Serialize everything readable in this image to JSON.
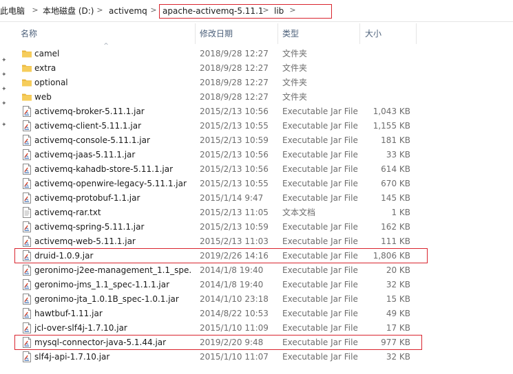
{
  "address_bar": {
    "crumbs": [
      "此电脑",
      "本地磁盘 (D:)",
      "activemq",
      "apache-activemq-5.11.1",
      "lib"
    ],
    "separator": ">"
  },
  "columns": {
    "name": "名称",
    "modified": "修改日期",
    "type": "类型",
    "size": "大小"
  },
  "files": [
    {
      "name": "camel",
      "modified": "2018/9/28 12:27",
      "type": "文件夹",
      "size": "",
      "icon": "folder-icon"
    },
    {
      "name": "extra",
      "modified": "2018/9/28 12:27",
      "type": "文件夹",
      "size": "",
      "icon": "folder-icon"
    },
    {
      "name": "optional",
      "modified": "2018/9/28 12:27",
      "type": "文件夹",
      "size": "",
      "icon": "folder-icon"
    },
    {
      "name": "web",
      "modified": "2018/9/28 12:27",
      "type": "文件夹",
      "size": "",
      "icon": "folder-icon"
    },
    {
      "name": "activemq-broker-5.11.1.jar",
      "modified": "2015/2/13 10:56",
      "type": "Executable Jar File",
      "size": "1,043 KB",
      "icon": "jar-file-icon"
    },
    {
      "name": "activemq-client-5.11.1.jar",
      "modified": "2015/2/13 10:55",
      "type": "Executable Jar File",
      "size": "1,155 KB",
      "icon": "jar-file-icon"
    },
    {
      "name": "activemq-console-5.11.1.jar",
      "modified": "2015/2/13 10:59",
      "type": "Executable Jar File",
      "size": "181 KB",
      "icon": "jar-file-icon"
    },
    {
      "name": "activemq-jaas-5.11.1.jar",
      "modified": "2015/2/13 10:56",
      "type": "Executable Jar File",
      "size": "33 KB",
      "icon": "jar-file-icon"
    },
    {
      "name": "activemq-kahadb-store-5.11.1.jar",
      "modified": "2015/2/13 10:56",
      "type": "Executable Jar File",
      "size": "614 KB",
      "icon": "jar-file-icon"
    },
    {
      "name": "activemq-openwire-legacy-5.11.1.jar",
      "modified": "2015/2/13 10:55",
      "type": "Executable Jar File",
      "size": "670 KB",
      "icon": "jar-file-icon"
    },
    {
      "name": "activemq-protobuf-1.1.jar",
      "modified": "2015/1/14 9:47",
      "type": "Executable Jar File",
      "size": "145 KB",
      "icon": "jar-file-icon"
    },
    {
      "name": "activemq-rar.txt",
      "modified": "2015/2/13 11:05",
      "type": "文本文档",
      "size": "1 KB",
      "icon": "text-file-icon"
    },
    {
      "name": "activemq-spring-5.11.1.jar",
      "modified": "2015/2/13 10:59",
      "type": "Executable Jar File",
      "size": "162 KB",
      "icon": "jar-file-icon"
    },
    {
      "name": "activemq-web-5.11.1.jar",
      "modified": "2015/2/13 11:03",
      "type": "Executable Jar File",
      "size": "111 KB",
      "icon": "jar-file-icon"
    },
    {
      "name": "druid-1.0.9.jar",
      "modified": "2019/2/26 14:16",
      "type": "Executable Jar File",
      "size": "1,806 KB",
      "icon": "jar-file-icon"
    },
    {
      "name": "geronimo-j2ee-management_1.1_spe...",
      "modified": "2014/1/8 19:40",
      "type": "Executable Jar File",
      "size": "20 KB",
      "icon": "jar-file-icon"
    },
    {
      "name": "geronimo-jms_1.1_spec-1.1.1.jar",
      "modified": "2014/1/8 19:40",
      "type": "Executable Jar File",
      "size": "32 KB",
      "icon": "jar-file-icon"
    },
    {
      "name": "geronimo-jta_1.0.1B_spec-1.0.1.jar",
      "modified": "2014/1/10 23:18",
      "type": "Executable Jar File",
      "size": "15 KB",
      "icon": "jar-file-icon"
    },
    {
      "name": "hawtbuf-1.11.jar",
      "modified": "2014/8/22 10:53",
      "type": "Executable Jar File",
      "size": "49 KB",
      "icon": "jar-file-icon"
    },
    {
      "name": "jcl-over-slf4j-1.7.10.jar",
      "modified": "2015/1/10 11:09",
      "type": "Executable Jar File",
      "size": "17 KB",
      "icon": "jar-file-icon"
    },
    {
      "name": "mysql-connector-java-5.1.44.jar",
      "modified": "2019/2/20 9:48",
      "type": "Executable Jar File",
      "size": "977 KB",
      "icon": "jar-file-icon"
    },
    {
      "name": "slf4j-api-1.7.10.jar",
      "modified": "2015/1/10 11:07",
      "type": "Executable Jar File",
      "size": "32 KB",
      "icon": "jar-file-icon"
    }
  ],
  "colors": {
    "highlight": "#d9232d",
    "header_text": "#4c607a",
    "folder": "#f4c650"
  }
}
